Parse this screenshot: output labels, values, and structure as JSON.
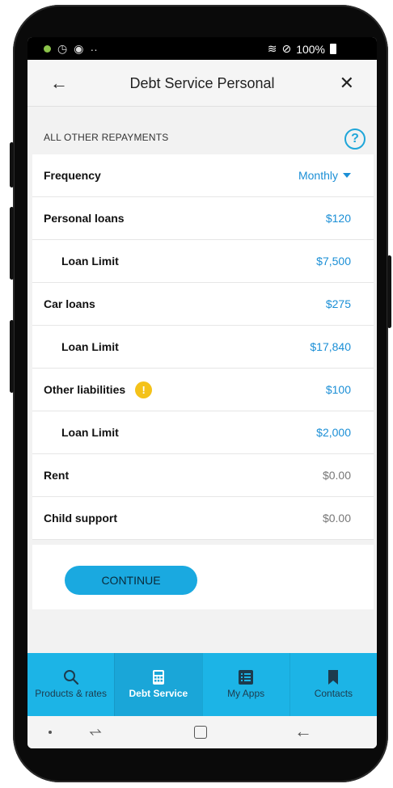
{
  "status_bar": {
    "left_icons": [
      "android-icon",
      "timer-icon",
      "sync-icon"
    ],
    "ellipsis": "··",
    "battery": "100%",
    "right_icons": [
      "wifi-icon",
      "dnd-icon",
      "battery-icon"
    ]
  },
  "header": {
    "title": "Debt Service Personal",
    "back_icon": "arrow-left-icon",
    "close_icon": "close-icon"
  },
  "section": {
    "label": "ALL OTHER REPAYMENTS",
    "help_glyph": "?"
  },
  "frequency": {
    "label": "Frequency",
    "value": "Monthly"
  },
  "rows": [
    {
      "label": "Personal loans",
      "value": "$120"
    },
    {
      "label": "Loan Limit",
      "value": "$7,500"
    },
    {
      "label": "Car loans",
      "value": "$275"
    },
    {
      "label": "Loan Limit",
      "value": "$17,840"
    },
    {
      "label": "Other liabilities",
      "value": "$100",
      "warning": "!"
    },
    {
      "label": "Loan Limit",
      "value": "$2,000"
    },
    {
      "label": "Rent",
      "value": "$0.00"
    },
    {
      "label": "Child support",
      "value": "$0.00"
    }
  ],
  "continue_label": "CONTINUE",
  "bottom_nav": {
    "items": [
      {
        "label": "Products & rates",
        "icon": "search-icon"
      },
      {
        "label": "Debt Service",
        "icon": "calculator-icon",
        "active": true
      },
      {
        "label": "My Apps",
        "icon": "list-icon"
      },
      {
        "label": "Contacts",
        "icon": "bookmark-icon"
      }
    ]
  },
  "colors": {
    "accent": "#1b8fd6",
    "nav_bg": "#1cb4e6",
    "warning": "#f4c21a"
  }
}
